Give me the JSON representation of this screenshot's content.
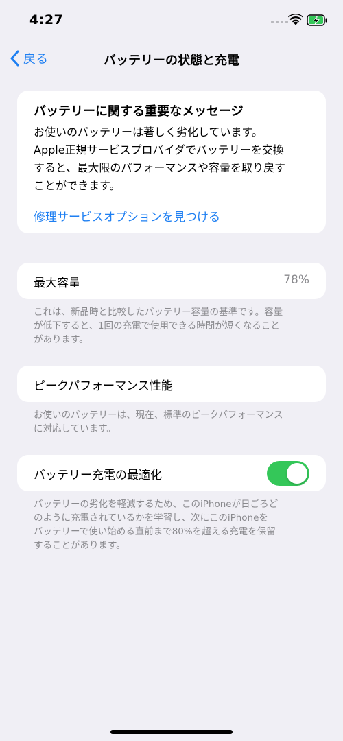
{
  "status_bar": {
    "time": "4:27"
  },
  "nav": {
    "back_label": "戻る",
    "title": "バッテリーの状態と充電"
  },
  "message": {
    "title": "バッテリーに関する重要なメッセージ",
    "body_lines": [
      "お使いのバッテリーは著しく劣化しています。",
      "Apple正規サービスプロバイダでバッテリーを交換",
      "すると、最大限のパフォーマンスや容量を取り戻す",
      "ことができます。"
    ],
    "link": "修理サービスオプションを見つける"
  },
  "capacity": {
    "label": "最大容量",
    "value": "78%",
    "footnote_lines": [
      "これは、新品時と比較したバッテリー容量の基準です。容量",
      "が低下すると、1回の充電で使用できる時間が短くなること",
      "があります。"
    ]
  },
  "peak": {
    "label": "ピークパフォーマンス性能",
    "footnote_lines": [
      "お使いのバッテリーは、現在、標準のピークパフォーマンス",
      "に対応しています。"
    ]
  },
  "optimize": {
    "label": "バッテリー充電の最適化",
    "toggle_on": true,
    "footnote_lines": [
      "バッテリーの劣化を軽減するため、このiPhoneが日ごろど",
      "のように充電されているかを学習し、次にこのiPhoneを",
      "バッテリーで使い始める直前まで80%を超える充電を保留",
      "することがあります。"
    ]
  },
  "icons": {
    "back": "chevron-left-icon",
    "wifi": "wifi-icon",
    "battery": "battery-charging-icon"
  },
  "colors": {
    "accent": "#1e7ff2",
    "toggle_on": "#34c759",
    "background": "#f0eff5"
  }
}
